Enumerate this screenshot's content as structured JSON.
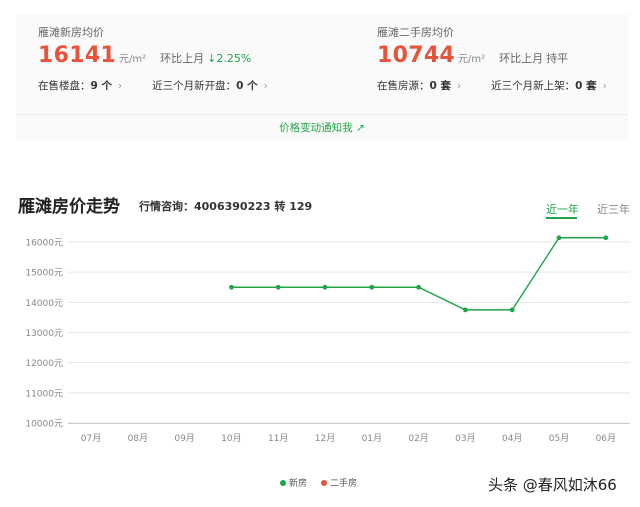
{
  "new_house": {
    "label": "雁滩新房均价",
    "price": "16141",
    "unit": "元/m²",
    "mom_label": "环比上月",
    "mom_value": "↓2.25%",
    "stat1_label": "在售楼盘：",
    "stat1_value": "9 个",
    "stat2_label": "近三个月新开盘：",
    "stat2_value": "0 个"
  },
  "second_hand": {
    "label": "雁滩二手房均价",
    "price": "10744",
    "unit": "元/m²",
    "mom_label": "环比上月",
    "mom_value": "持平",
    "stat1_label": "在售房源：",
    "stat1_value": "0 套",
    "stat2_label": "近三个月新上架：",
    "stat2_value": "0 套"
  },
  "arrow": "›",
  "notify": "价格变动通知我 ↗",
  "trend": {
    "title": "雁滩房价走势",
    "hotline": "行情咨询：4006390223 转 129",
    "tab_one_year": "近一年",
    "tab_three_years": "近三年"
  },
  "colors": {
    "new": "#21a44a",
    "second": "#e8533b"
  },
  "chart_data": {
    "type": "line",
    "categories": [
      "07月",
      "08月",
      "09月",
      "10月",
      "11月",
      "12月",
      "01月",
      "02月",
      "03月",
      "04月",
      "05月",
      "06月"
    ],
    "y_ticks": [
      "10000元",
      "11000元",
      "12000元",
      "13000元",
      "14000元",
      "15000元",
      "16000元"
    ],
    "ylim": [
      10000,
      16000
    ],
    "series": [
      {
        "name": "新房",
        "values": [
          null,
          null,
          null,
          14500,
          14500,
          14500,
          14500,
          14500,
          13750,
          13750,
          16141,
          16141
        ]
      },
      {
        "name": "二手房",
        "values": [
          null,
          null,
          null,
          null,
          null,
          null,
          null,
          null,
          null,
          null,
          null,
          null
        ]
      }
    ],
    "legend": "bottom-center",
    "grid": true
  },
  "watermark": "头条 @春风如沐66"
}
